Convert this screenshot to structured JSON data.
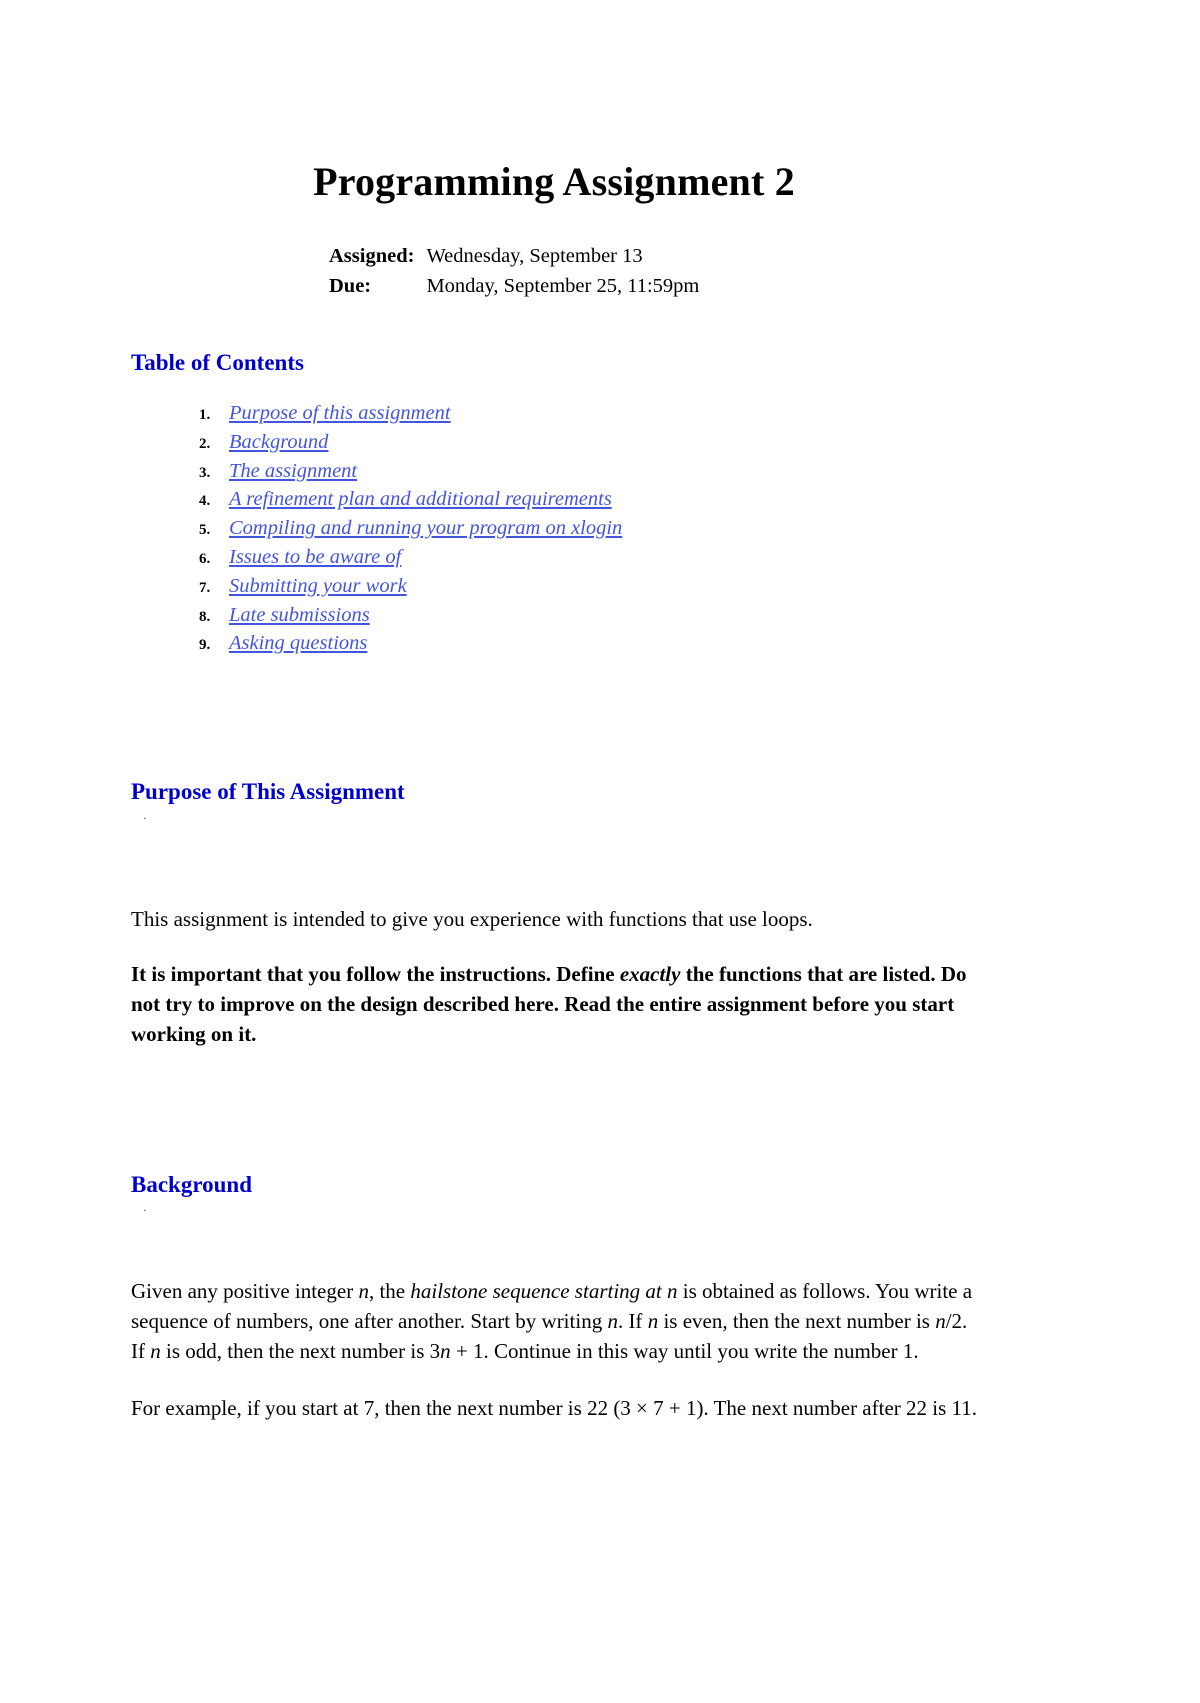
{
  "document": {
    "title": "Programming Assignment 2",
    "meta": {
      "assigned_label": "Assigned:",
      "assigned_value": "Wednesday, September 13",
      "due_label": "Due:",
      "due_value": "Monday, September 25, 11:59pm"
    },
    "link_color": "#4455DD",
    "heading_color": "#0000CC",
    "toc": {
      "heading": "Table of Contents",
      "items": [
        {
          "number": "1.",
          "label": "Purpose of this assignment"
        },
        {
          "number": "2.",
          "label": "Background"
        },
        {
          "number": "3.",
          "label": "The assignment"
        },
        {
          "number": "4.",
          "label": "A refinement plan and additional requirements"
        },
        {
          "number": "5.",
          "label": "Compiling and running your program on xlogin"
        },
        {
          "number": "6.",
          "label": "Issues to be aware of"
        },
        {
          "number": "7.",
          "label": "Submitting your work"
        },
        {
          "number": "8.",
          "label": "Late submissions"
        },
        {
          "number": "9.",
          "label": "Asking questions"
        }
      ]
    },
    "purpose": {
      "heading": "Purpose of This Assignment",
      "anchor_mark": "·",
      "paragraph_1": "This assignment is intended to give you experience with functions that use loops.",
      "bold_paragraph": {
        "part_1": "It is important that you follow the instructions. Define ",
        "emphasis": "exactly",
        "part_2": " the functions that are listed. Do not try to improve on the design described here. Read the entire assignment before you start working on it."
      }
    },
    "background": {
      "heading": "Background",
      "anchor_mark": "·",
      "paragraph_1": {
        "seg_1": "Given any positive integer ",
        "var_1": "n",
        "seg_2": ", the ",
        "italic_1": "hailstone sequence starting at n",
        "seg_3": " is obtained as follows. You write a sequence of numbers, one after another. Start by writing ",
        "var_2": "n",
        "seg_4": ". If ",
        "var_3": "n",
        "seg_5": " is even, then the next number is ",
        "var_4": "n",
        "seg_6": "/2. If ",
        "var_5": "n",
        "seg_7": " is odd, then the next number is 3",
        "var_6": "n",
        "seg_8": " + 1. Continue in this way until you write the number 1."
      },
      "paragraph_2": "For example, if you start at 7, then the next number is 22 (3 × 7 + 1). The next number after 22 is 11."
    }
  }
}
